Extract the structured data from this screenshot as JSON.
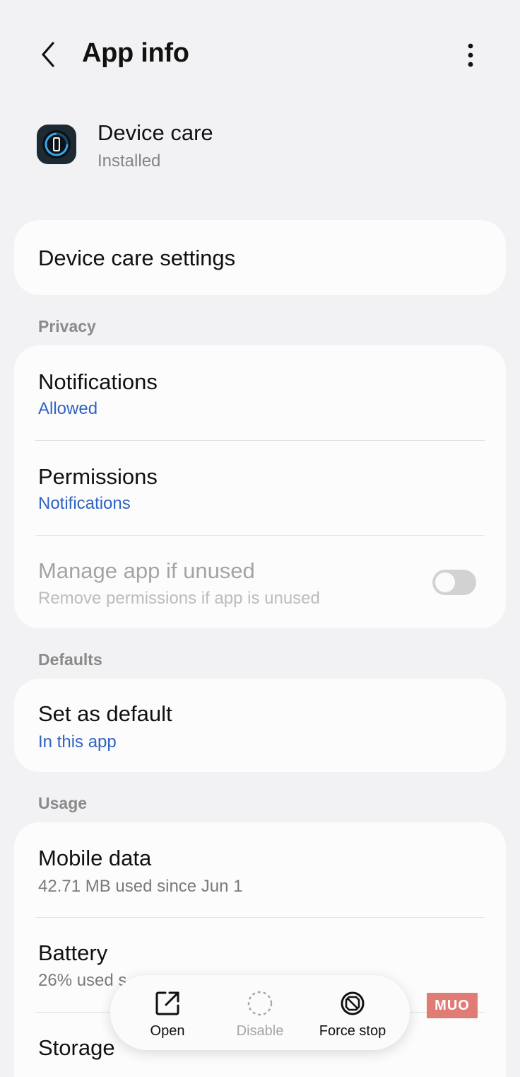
{
  "header": {
    "title": "App info"
  },
  "app": {
    "name": "Device care",
    "status": "Installed",
    "icon": "device-care-icon"
  },
  "settings_card": {
    "label": "Device care settings"
  },
  "privacy": {
    "section_label": "Privacy",
    "items": [
      {
        "title": "Notifications",
        "subtitle": "Allowed"
      },
      {
        "title": "Permissions",
        "subtitle": "Notifications"
      },
      {
        "title": "Manage app if unused",
        "subtitle": "Remove permissions if app is unused",
        "toggle_on": false,
        "enabled": false
      }
    ]
  },
  "defaults": {
    "section_label": "Defaults",
    "items": [
      {
        "title": "Set as default",
        "subtitle": "In this app"
      }
    ]
  },
  "usage": {
    "section_label": "Usage",
    "items": [
      {
        "title": "Mobile data",
        "subtitle": "42.71 MB used since Jun 1"
      },
      {
        "title": "Battery",
        "subtitle": "26% used s"
      },
      {
        "title": "Storage"
      }
    ]
  },
  "bottom_bar": {
    "open": "Open",
    "disable": "Disable",
    "force_stop": "Force stop"
  },
  "watermark": "MUO",
  "colors": {
    "accent": "#2f63c0",
    "background": "#f2f2f4",
    "card": "#fcfcfd"
  }
}
